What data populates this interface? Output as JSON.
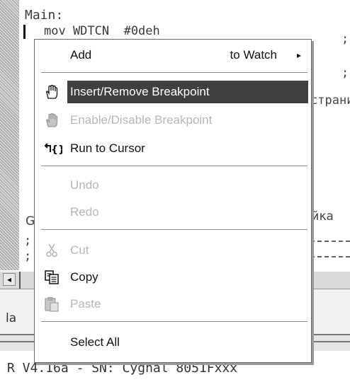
{
  "editor": {
    "label_main": "Main:",
    "line_mov": "mov WDTCN  #0deh",
    "frag_right_1": ";",
    "frag_right_2": ";",
    "frag_right_3": "страни",
    "frag_right_4": "йка",
    "frag_g": "G",
    "frag_semi_1": ";",
    "frag_semi_2": ";"
  },
  "bottom_panel": {
    "tab_label": "la"
  },
  "status_bar": {
    "text": "R V4.16a - SN: Cygnal 8051Fxxx"
  },
  "hscroll": {
    "left_arrow": "◂"
  },
  "context_menu": {
    "add": {
      "label": "Add",
      "right": "to Watch",
      "arrow": "▸"
    },
    "insert_remove_breakpoint": "Insert/Remove Breakpoint",
    "enable_disable_breakpoint": "Enable/Disable Breakpoint",
    "run_to_cursor": "Run to Cursor",
    "undo": "Undo",
    "redo": "Redo",
    "cut": "Cut",
    "copy": "Copy",
    "paste": "Paste",
    "select_all": "Select All"
  },
  "icons": {
    "hand": "hand-icon",
    "hand_disabled": "hand-disabled-icon",
    "run_to_cursor": "run-to-cursor-icon",
    "cut": "scissors-icon",
    "copy": "copy-icon",
    "paste": "paste-icon"
  },
  "colors": {
    "highlight": "#3f3f3f",
    "disabled_text": "#b6b6b6"
  }
}
